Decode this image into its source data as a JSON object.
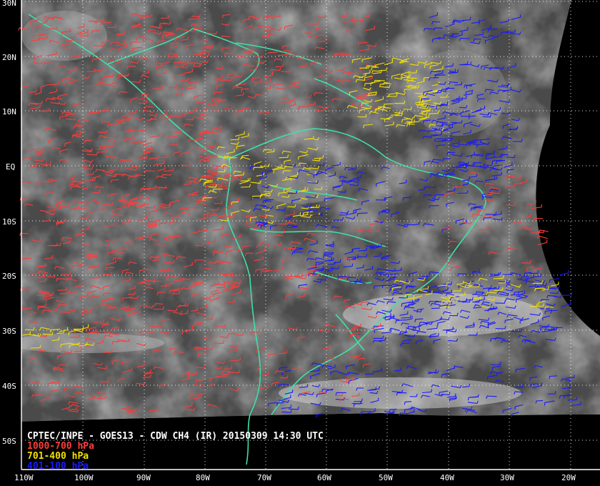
{
  "map": {
    "title": "CPTEC/INPE - GOES13 - CDW CH4 (IR) 20150309 14:30 UTC",
    "legend": [
      {
        "label": "1000-700 hPa",
        "color": "#ff3b3b"
      },
      {
        "label": "701-400 hPa",
        "color": "#f0e000"
      },
      {
        "label": "401-100 hPa",
        "color": "#1a1aff"
      }
    ],
    "lat_labels": [
      "30N",
      "20N",
      "10N",
      "EQ",
      "10S",
      "20S",
      "30S",
      "40S",
      "50S"
    ],
    "lon_labels": [
      "110W",
      "100W",
      "90W",
      "80W",
      "70W",
      "60W",
      "50W",
      "40W",
      "30W",
      "20W"
    ],
    "colors": {
      "coastline": "#3ee0a8",
      "grid": "#ffffff",
      "background": "#000000",
      "imagery": "#4a4a4a"
    }
  }
}
